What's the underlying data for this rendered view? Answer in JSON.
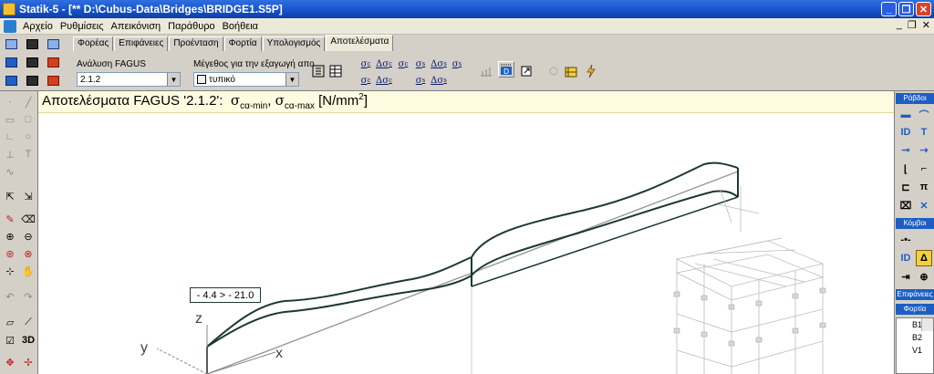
{
  "window": {
    "title": "Statik-5 - [** D:\\Cubus-Data\\Bridges\\BRIDGE1.S5P]",
    "buttons": [
      "_",
      "❐",
      "✕"
    ]
  },
  "menubar": {
    "items": [
      "Αρχείο",
      "Ρυθμίσεις",
      "Απεικόνιση",
      "Παράθυρο",
      "Βοήθεια"
    ],
    "mdi_buttons": [
      "_",
      "❐",
      "✕"
    ]
  },
  "tabs": [
    "Φορέας",
    "Επιφάνειες",
    "Προένταση",
    "Φορτία",
    "Υπολογισμός",
    "Αποτελέσματα"
  ],
  "active_tab": "Αποτελέσματα",
  "analysis": {
    "label": "Ανάλυση FAGUS",
    "value": "2.1.2"
  },
  "output_size": {
    "label": "Μέγεθος για την εξαγωγή απο",
    "value": "τυπικό"
  },
  "stress_buttons": {
    "row1": [
      {
        "main": "σ",
        "sub": "c"
      },
      {
        "main": "Δσ",
        "sub": "c"
      },
      {
        "main": "σ",
        "sub": "c"
      },
      {
        "main": "σ",
        "sub": "s"
      },
      {
        "main": "Δσ",
        "sub": "s"
      },
      {
        "main": "σ",
        "sub": "s"
      }
    ],
    "row2": [
      {
        "main": "σ",
        "sub": "c"
      },
      {
        "main": "Δσ",
        "sub": "c"
      },
      {
        "main": "σ",
        "sub": "s"
      },
      {
        "main": "Δσ",
        "sub": "s"
      }
    ]
  },
  "result_title": {
    "prefix": "Αποτελέσματα FAGUS '2.1.2':",
    "sym1": "σ",
    "sub1": "cα-min",
    "sep": ",",
    "sym2": "σ",
    "sub2": "cα-max",
    "unit": "[N/mm",
    "unit_sup": "2",
    "unit_end": "]"
  },
  "annotation": "- 4.4 > - 21.0",
  "axes": {
    "z": "z",
    "y": "y",
    "x": "x"
  },
  "left_toolbar": {
    "labels": [
      "T",
      "3D"
    ]
  },
  "right_panel": {
    "sections": [
      "Ράβδοι",
      "Κόμβοι",
      "Επιφάνειες",
      "Φορτία"
    ],
    "id_label": "ID",
    "load_cases": [
      "B1",
      "B2",
      "V1"
    ]
  },
  "colors": {
    "titlebar": "#1450c8",
    "result_bg": "#fffbe0",
    "diagram_line": "#1d3a2a",
    "panel_head": "#1d5ec4"
  }
}
